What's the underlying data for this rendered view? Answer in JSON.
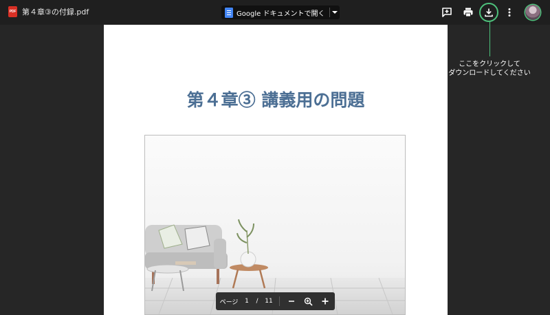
{
  "topbar": {
    "file_badge": "PDF",
    "filename": "第４章③の付録.pdf",
    "open_with_label": "Google ドキュメントで開く",
    "open_with_icon": "docs-icon",
    "icons": [
      "add-comment-icon",
      "print-icon",
      "download-icon",
      "more-vert-icon",
      "avatar"
    ]
  },
  "callout": {
    "line1": "ここをクリックして",
    "line2": "ダウンロードしてください",
    "color": "#4ec27c"
  },
  "document": {
    "title": "第４章③ 講義用の問題",
    "title_color": "#4c6f94"
  },
  "pager": {
    "label": "ページ",
    "current": "1",
    "separator": "/",
    "total": "11",
    "icons": [
      "zoom-out-icon",
      "zoom-in-icon",
      "add-icon"
    ]
  }
}
